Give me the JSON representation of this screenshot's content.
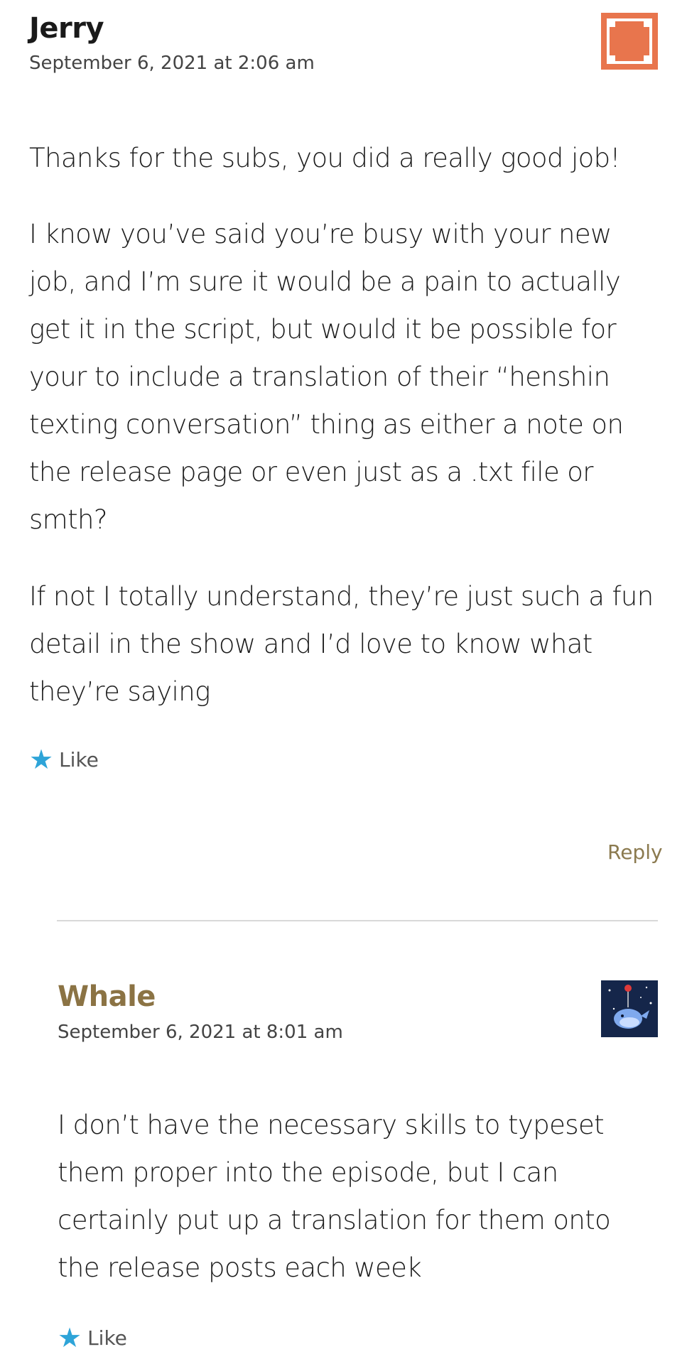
{
  "comments": [
    {
      "author": "Jerry",
      "date": "September 6, 2021 at 2:06 am",
      "paragraphs": [
        "Thanks for the subs, you did a really good job!",
        "I know you’ve said you’re busy with your new job, and I’m sure it would be a pain to actually get it in the script, but would it be possible for your to include a translation of their “henshin texting conversation” thing as either a note on the release page or even just as a .txt file or smth?",
        "If not I totally understand, they’re just such a fun detail in the show and I’d love to know what they’re saying"
      ],
      "like_label": "Like",
      "reply_label": "Reply",
      "avatar_icon": "orange-square-identicon",
      "avatar_color": "#e8754d"
    },
    {
      "author": "Whale",
      "date": "September 6, 2021 at 8:01 am",
      "paragraphs": [
        "I don’t have the necessary skills to typeset them proper into the episode, but I can certainly put up a translation for them onto the release posts each week"
      ],
      "like_label": "Like",
      "avatar_icon": "whale-balloon-avatar",
      "author_color": "#8b7344"
    }
  ],
  "icons": {
    "like": "star-icon"
  },
  "colors": {
    "star": "#2ea4d8",
    "reply": "#8b7a4f",
    "divider": "#d9d9d9"
  }
}
